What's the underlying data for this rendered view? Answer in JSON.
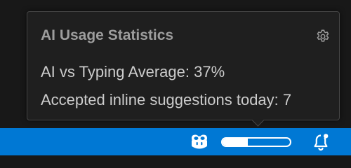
{
  "popup": {
    "title": "AI Usage Statistics",
    "settings_icon": "gear-icon",
    "lines": [
      "AI vs Typing Average: 37%",
      "Accepted inline suggestions today: 7"
    ]
  },
  "status_bar": {
    "color": "#0078d4",
    "copilot_icon": "copilot-icon",
    "usage_meter": {
      "level": 0.37
    },
    "notification_icon": "bell-icon"
  }
}
